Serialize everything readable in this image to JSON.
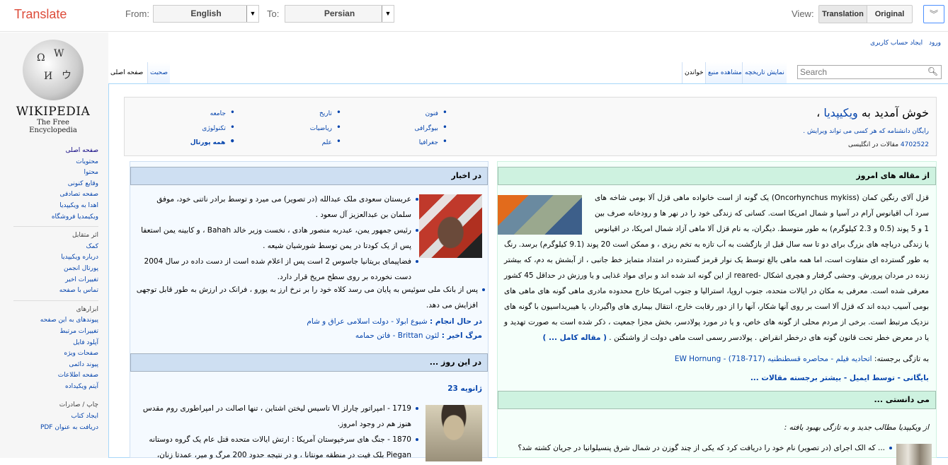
{
  "translate_bar": {
    "brand": "Translate",
    "from_label": "From:",
    "from_value": "English",
    "to_label": "To:",
    "to_value": "Persian",
    "view_label": "View:",
    "view_translation": "Translation",
    "view_original": "Original",
    "active_view": "Translation",
    "accent_color": "#dd4b39"
  },
  "logo": {
    "wordmark": "WIKIPEDIA",
    "tagline": "The Free Encyclopedia"
  },
  "personal": [
    "ورود",
    "ایجاد حساب کاربری"
  ],
  "tabs": {
    "left": [
      "صفحه اصلی",
      "صحبت"
    ],
    "right": [
      "خواندن",
      "مشاهده منبع",
      "نمایش تاریخچه"
    ]
  },
  "search": {
    "placeholder": "Search"
  },
  "sidebar": {
    "group1": [
      "صفحه اصلی",
      "محتویات",
      "محتوا",
      "وقایع کنونی",
      "صفحه تصادفی",
      "اهدا به ویکیپدیا",
      "ویکیمدیا فروشگاه"
    ],
    "group2": [
      "اثر متقابل",
      "کمک",
      "درباره ویکیپدیا",
      "پورتال انجمن",
      "تغییرات اخیر",
      "تماس با صفحه"
    ],
    "group3": [
      "ابزارهای",
      "پیوندهای به این صفحه",
      "تغییرات مرتبط",
      "آپلود فایل",
      "صفحات ویژه",
      "پیوند دائمی",
      "صفحه اطلاعات",
      "آیتم ویکیداده"
    ],
    "group4": [
      "چاپ / صادرات",
      "ایجاد کتاب",
      "دریافت به عنوان PDF"
    ]
  },
  "welcome": {
    "title_plain": "خوش آمدید به ",
    "title_link": "ویکیپدیا",
    "title_end": " ،",
    "subtitle": "رایگان دانشنامه که هر کسی می تواند ویرایش .",
    "count": "4702522",
    "count_suffix": " مقالات در انگلیسی",
    "portals": [
      [
        "فنون",
        "بیوگرافی",
        "جغرافیا"
      ],
      [
        "تاریخ",
        "ریاضیات",
        "علم"
      ],
      [
        "جامعه",
        "تکنولوژی",
        "همه پورتال"
      ]
    ]
  },
  "featured": {
    "heading": "از مقاله های امروز",
    "paragraph": "قزل آلای رنگین کمان (Oncorhynchus mykiss) یک گونه از است خانواده ماهی قزل آلا بومی شاخه های سرد آب اقیانوس آرام در آسیا و شمال امریکا است. کسانی که زندگی خود را در نهر ها و رودخانه صرف بین 1 و 5 پوند (0.5 و 2.3 کیلوگرم) به طور متوسط. دیگران، به نام قزل آلا ماهی آزاد شمال امریکا، در اقیانوس یا زندگی دریاچه های بزرگ برای دو تا سه سال قبل از بازگشت به آب تازه به تخم ریزی ، و ممکن است 20 پوند (9.1 کیلوگرم) برسد. رنگ به طور گسترده ای متفاوت است، اما همه ماهی بالغ توسط یک نوار قرمز گسترده در امتداد متمایز خط جانبی ، از آبشش به دم، که بیشتر زنده در مردان پرورش. وحشی گرفتار و هچری اشکال -reared از این گونه اند شده اند و برای مواد غذایی و یا ورزش در حداقل 45 کشور معرفی شده است. معرفی به مکان در ایالات متحده، جنوب اروپا، استرالیا و جنوب امریکا خارج محدوده مادری ماهی گونه های ماهی های بومی آسیب دیده اند که قزل آلا است بر روی آنها شکار، آنها را از دور رقابت خارج، انتقال بیماری های واگیردار، یا هیبریداسیون با گونه های نزدیک مرتبط است. برخی از مردم محلی از گونه های خاص، و یا در مورد پولادسر، بخش مجزا جمعیت ، ذکر شده است به صورت تهدید و یا در معرض خطر تحت قانون گونه های درخطر انقراض . پولادسر رسمی است ماهی دولت از واشنگتن .",
    "more": "( مقاله کامل ... )",
    "recent_label": "به تازگی برجسته:",
    "recent": "اتحادیه فیلم - محاصره قسطنطنیه (717-718) - EW Hornung",
    "archive": "بایگانی - توسط ایمیل - بیشتر برجسته مقالات ..."
  },
  "dyk": {
    "heading": "می دانستی ...",
    "intro": "از ویکیپدیا مطالب جدید و به تازگی بهبود یافته :",
    "items": [
      "... که الک اجرای (در تصویر) نام خود را دریافت کرد که یکی از چند گوزن در شمال شرق پنسیلوانیا در جریان کشته شد؟"
    ]
  },
  "news": {
    "heading": "در اخبار",
    "items": [
      "عربستان سعودی ملک عبدالله (در تصویر) می میرد و توسط برادر ناتنی خود، موفق سلمان بن عبدالعزیز آل سعود .",
      "رئیس جمهور یمن، عبدربه منصور هادی ، نخست وزیر خالد Bahah ، و کابینه یمن استعفا پس از یک کودتا در یمن توسط شورشیان شیعه .",
      "فضاپیمای بریتانیا جاسوس 2 است پس از اعلام شده است از دست داده در سال 2004 دست نخورده بر روی سطح مریخ قرار دارد.",
      "پس از بانک ملی سوئیس به پایان می رسد کلاه خود را بر نرخ ارز به یورو ، فرانک در ارزش به طور قابل توجهی افزایش می دهد."
    ],
    "ongoing_label": "در حال انجام :",
    "ongoing": "شیوع ابولا - دولت اسلامی عراق و شام",
    "deaths_label": "مرگ اخیر :",
    "deaths": "لئون Brittan - فاتن حمامه"
  },
  "onthisday": {
    "heading": "در این روز ...",
    "date": "ژانویه 23",
    "items": [
      "1719 - امپراتور چارلز VI تاسیس لیختن اشتاین ، تنها اصالت در امپراطوری روم مقدس هنوز هم در وجود امروز.",
      "1870 - جنگ های سرخپوستان آمریکا : ارتش ایالات متحده قتل عام یک گروه دوستانه Piegan بلک فیت در منطقه مونتانا ، و در نتیجه حدود 200 مرگ و میر، عمدتا زنان،"
    ]
  },
  "colors": {
    "featured_header": "#cef2e0",
    "featured_bg": "#f5fffa",
    "news_header": "#cedff2",
    "news_bg": "#f5faff",
    "link": "#0645ad"
  }
}
